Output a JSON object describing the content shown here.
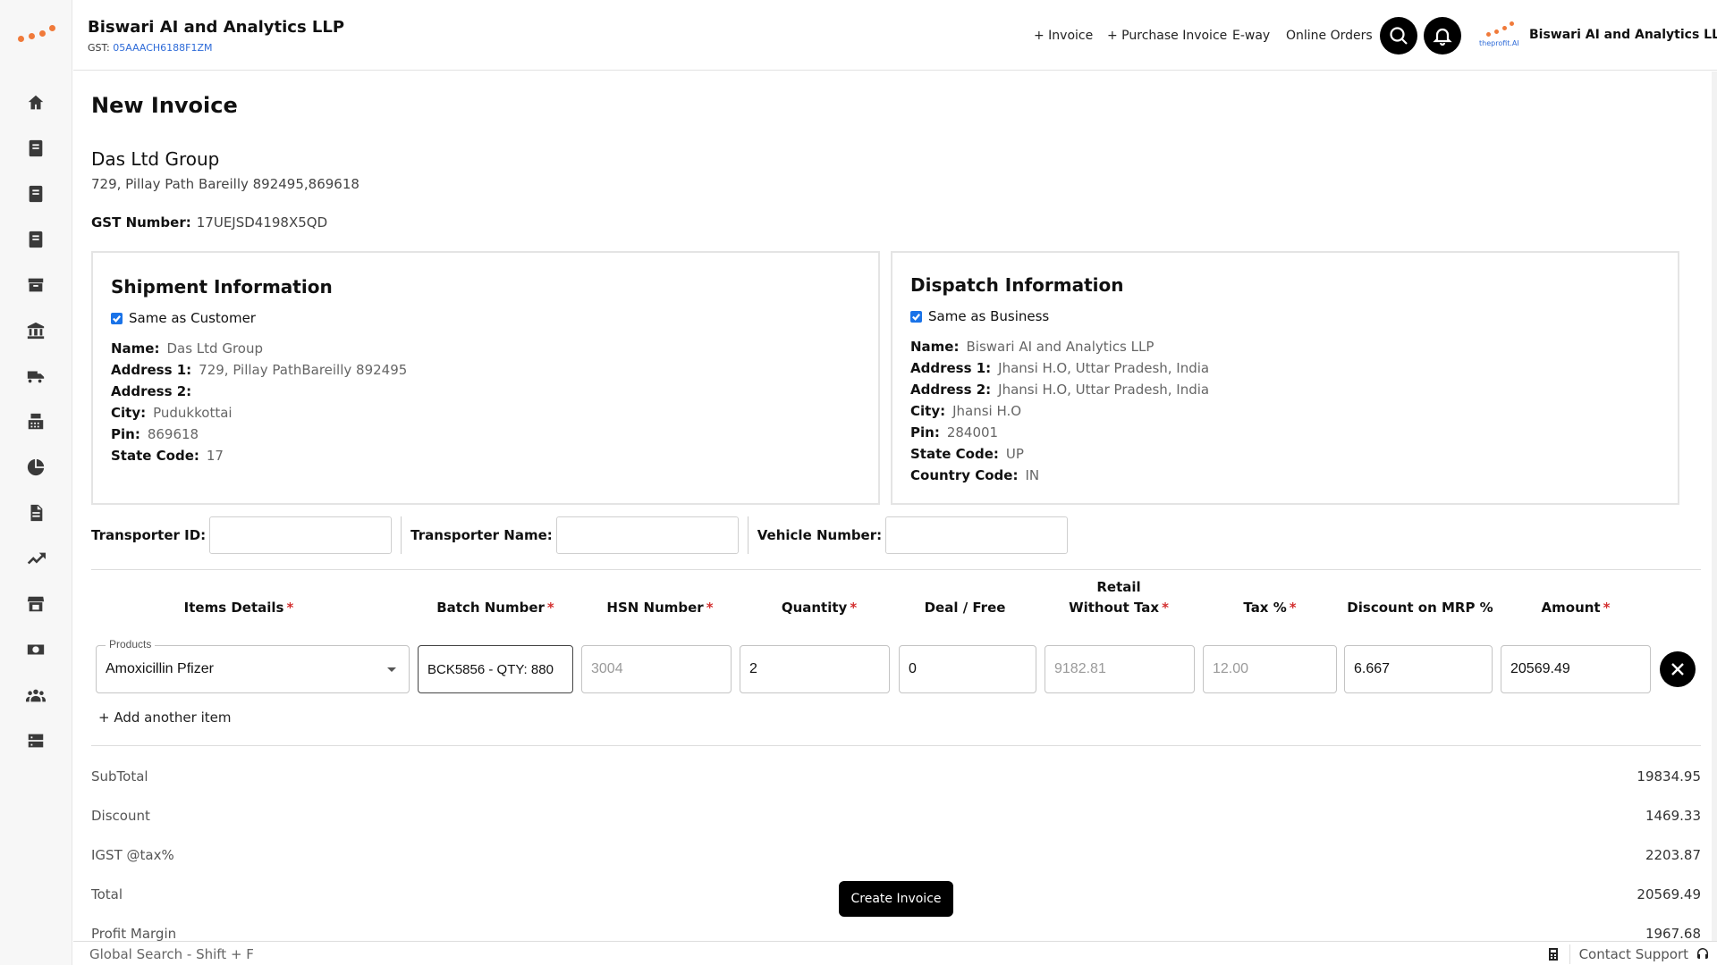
{
  "header": {
    "business_name": "Biswari AI and Analytics LLP",
    "gst_label": "GST:",
    "gst_value": "05AAACH6188F1ZM",
    "nav": {
      "invoice": "+ Invoice",
      "purchase_invoice": "+ Purchase Invoice",
      "eway": "E-way",
      "online_orders": "Online Orders"
    },
    "brand_logo_text": "theprofit.AI",
    "brand_name": "Biswari AI and Analytics LLP"
  },
  "page": {
    "title": "New Invoice",
    "customer": {
      "name": "Das Ltd Group",
      "address": "729, Pillay Path Bareilly 892495,869618",
      "gst_label": "GST Number:",
      "gst_value": "17UEJSD4198X5QD"
    },
    "shipment": {
      "title": "Shipment Information",
      "checkbox_label": "Same as Customer",
      "fields": [
        {
          "label": "Name:",
          "value": "Das Ltd Group"
        },
        {
          "label": "Address 1:",
          "value": "729, Pillay PathBareilly 892495"
        },
        {
          "label": "Address 2:",
          "value": ""
        },
        {
          "label": "City:",
          "value": "Pudukkottai"
        },
        {
          "label": "Pin:",
          "value": "869618"
        },
        {
          "label": "State Code:",
          "value": "17"
        }
      ]
    },
    "dispatch": {
      "title": "Dispatch Information",
      "checkbox_label": "Same as Business",
      "fields": [
        {
          "label": "Name:",
          "value": "Biswari AI and Analytics LLP"
        },
        {
          "label": "Address 1:",
          "value": "Jhansi H.O, Uttar Pradesh, India"
        },
        {
          "label": "Address 2:",
          "value": "Jhansi H.O, Uttar Pradesh, India"
        },
        {
          "label": "City:",
          "value": "Jhansi H.O"
        },
        {
          "label": "Pin:",
          "value": "284001"
        },
        {
          "label": "State Code:",
          "value": "UP"
        },
        {
          "label": "Country Code:",
          "value": "IN"
        }
      ]
    },
    "transporter": {
      "id_label": "Transporter ID:",
      "name_label": "Transporter Name:",
      "vehicle_label": "Vehicle Number:"
    },
    "items": {
      "columns": {
        "items_details": "Items Details",
        "batch_number": "Batch Number",
        "hsn_number": "HSN Number",
        "quantity": "Quantity",
        "deal_free": "Deal / Free",
        "retail_line1": "Retail",
        "retail_line2": "Without Tax",
        "tax": "Tax %",
        "discount": "Discount on MRP %",
        "amount": "Amount"
      },
      "required_mark": "*",
      "row": {
        "products_label": "Products",
        "product": "Amoxicillin Pfizer",
        "batch": "BCK5856 - QTY: 880",
        "hsn": "3004",
        "quantity": "2",
        "deal_free": "0",
        "retail": "9182.81",
        "tax": "12.00",
        "discount": "6.667",
        "amount": "20569.49"
      },
      "add_item": "+ Add another item"
    },
    "summary": [
      {
        "label": "SubTotal",
        "value": "19834.95"
      },
      {
        "label": "Discount",
        "value": "1469.33"
      },
      {
        "label": "IGST @tax%",
        "value": "2203.87"
      },
      {
        "label": "Total",
        "value": "20569.49"
      },
      {
        "label": "Profit Margin",
        "value": "1967.68"
      }
    ],
    "create_button": "Create Invoice"
  },
  "footer": {
    "global_search": "Global Search - Shift + F",
    "contact_support": "Contact Support"
  },
  "colors": {
    "accent": "#f07a3a",
    "link": "#2e6bd8",
    "required": "#d32f2f",
    "checkbox": "#1a73e8"
  }
}
